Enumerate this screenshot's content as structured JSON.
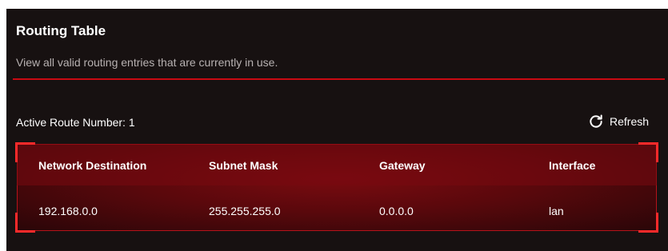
{
  "section": {
    "title": "Routing Table",
    "description": "View all valid routing entries that are currently in use.",
    "active_route_label": "Active Route Number: 1",
    "refresh_label": "Refresh"
  },
  "table": {
    "headers": [
      "Network Destination",
      "Subnet Mask",
      "Gateway",
      "Interface"
    ],
    "rows": [
      [
        "192.168.0.0",
        "255.255.255.0",
        "0.0.0.0",
        "lan"
      ]
    ]
  },
  "colors": {
    "accent": "#c90a12",
    "background": "#171111"
  },
  "icons": {
    "refresh": "refresh-icon"
  }
}
